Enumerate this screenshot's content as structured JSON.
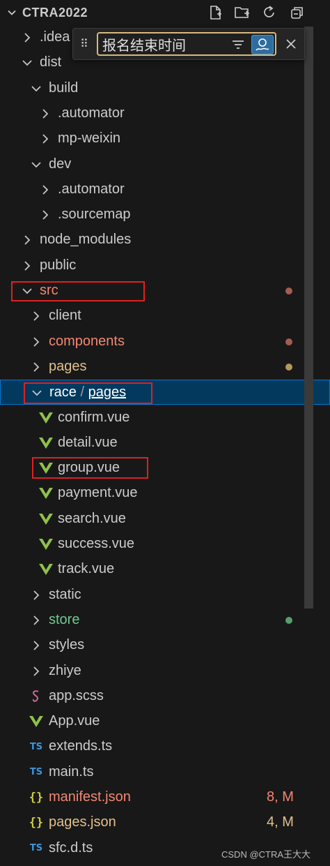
{
  "header": {
    "title": "CTRA2022"
  },
  "find": {
    "query": "报名结束时间"
  },
  "colors": {
    "modified": "#e2c08d",
    "error": "#f48771",
    "untracked": "#73c991",
    "default": "#cccccc",
    "vue": "#8fc14a"
  },
  "tree": [
    {
      "label": ".idea",
      "kind": "folder",
      "state": "collapsed",
      "depth": 1,
      "color": "default"
    },
    {
      "label": "dist",
      "kind": "folder",
      "state": "expanded",
      "depth": 1,
      "color": "default"
    },
    {
      "label": "build",
      "kind": "folder",
      "state": "expanded",
      "depth": 2,
      "color": "default"
    },
    {
      "label": ".automator",
      "kind": "folder",
      "state": "collapsed",
      "depth": 3,
      "color": "default"
    },
    {
      "label": "mp-weixin",
      "kind": "folder",
      "state": "collapsed",
      "depth": 3,
      "color": "default"
    },
    {
      "label": "dev",
      "kind": "folder",
      "state": "expanded",
      "depth": 2,
      "color": "default"
    },
    {
      "label": ".automator",
      "kind": "folder",
      "state": "collapsed",
      "depth": 3,
      "color": "default"
    },
    {
      "label": ".sourcemap",
      "kind": "folder",
      "state": "collapsed",
      "depth": 3,
      "color": "default"
    },
    {
      "label": "node_modules",
      "kind": "folder",
      "state": "collapsed",
      "depth": 1,
      "color": "default"
    },
    {
      "label": "public",
      "kind": "folder",
      "state": "collapsed",
      "depth": 1,
      "color": "default"
    },
    {
      "label": "src",
      "kind": "folder",
      "state": "expanded",
      "depth": 1,
      "color": "error",
      "dot": "error"
    },
    {
      "label": "client",
      "kind": "folder",
      "state": "collapsed",
      "depth": 2,
      "color": "default"
    },
    {
      "label": "components",
      "kind": "folder",
      "state": "collapsed",
      "depth": 2,
      "color": "error",
      "dot": "error"
    },
    {
      "label": "pages",
      "kind": "folder",
      "state": "collapsed",
      "depth": 2,
      "color": "modified",
      "dot": "modified"
    },
    {
      "label": "race",
      "label2": "pages",
      "kind": "folder",
      "state": "expanded",
      "depth": 2,
      "color": "default",
      "selected": true
    },
    {
      "label": "confirm.vue",
      "kind": "vue",
      "depth": 3,
      "color": "default"
    },
    {
      "label": "detail.vue",
      "kind": "vue",
      "depth": 3,
      "color": "default"
    },
    {
      "label": "group.vue",
      "kind": "vue",
      "depth": 3,
      "color": "default"
    },
    {
      "label": "payment.vue",
      "kind": "vue",
      "depth": 3,
      "color": "default"
    },
    {
      "label": "search.vue",
      "kind": "vue",
      "depth": 3,
      "color": "default"
    },
    {
      "label": "success.vue",
      "kind": "vue",
      "depth": 3,
      "color": "default"
    },
    {
      "label": "track.vue",
      "kind": "vue",
      "depth": 3,
      "color": "default"
    },
    {
      "label": "static",
      "kind": "folder",
      "state": "collapsed",
      "depth": 2,
      "color": "default"
    },
    {
      "label": "store",
      "kind": "folder",
      "state": "collapsed",
      "depth": 2,
      "color": "untracked",
      "dot": "untracked"
    },
    {
      "label": "styles",
      "kind": "folder",
      "state": "collapsed",
      "depth": 2,
      "color": "default"
    },
    {
      "label": "zhiye",
      "kind": "folder",
      "state": "collapsed",
      "depth": 2,
      "color": "default"
    },
    {
      "label": "app.scss",
      "kind": "scss",
      "depth": 2,
      "color": "default"
    },
    {
      "label": "App.vue",
      "kind": "vue",
      "depth": 2,
      "color": "default"
    },
    {
      "label": "extends.ts",
      "kind": "ts",
      "depth": 2,
      "color": "default"
    },
    {
      "label": "main.ts",
      "kind": "ts",
      "depth": 2,
      "color": "default"
    },
    {
      "label": "manifest.json",
      "kind": "json",
      "depth": 2,
      "color": "error",
      "badge": "8, M"
    },
    {
      "label": "pages.json",
      "kind": "json",
      "depth": 2,
      "color": "modified",
      "badge": "4, M"
    },
    {
      "label": "sfc.d.ts",
      "kind": "ts",
      "depth": 2,
      "color": "default"
    }
  ],
  "watermark": "CSDN @CTRA王大大"
}
